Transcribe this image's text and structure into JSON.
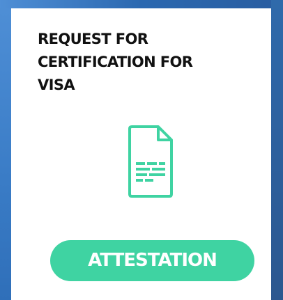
{
  "card": {
    "title_lines": [
      "REQUEST FOR",
      "CERTIFICATION FOR",
      "VISA"
    ],
    "icon": "document-icon",
    "button_label": "ATTESTATION"
  },
  "colors": {
    "accent": "#3fd3a2",
    "background_blue": "#2f6fb9",
    "title_text": "#111111"
  }
}
